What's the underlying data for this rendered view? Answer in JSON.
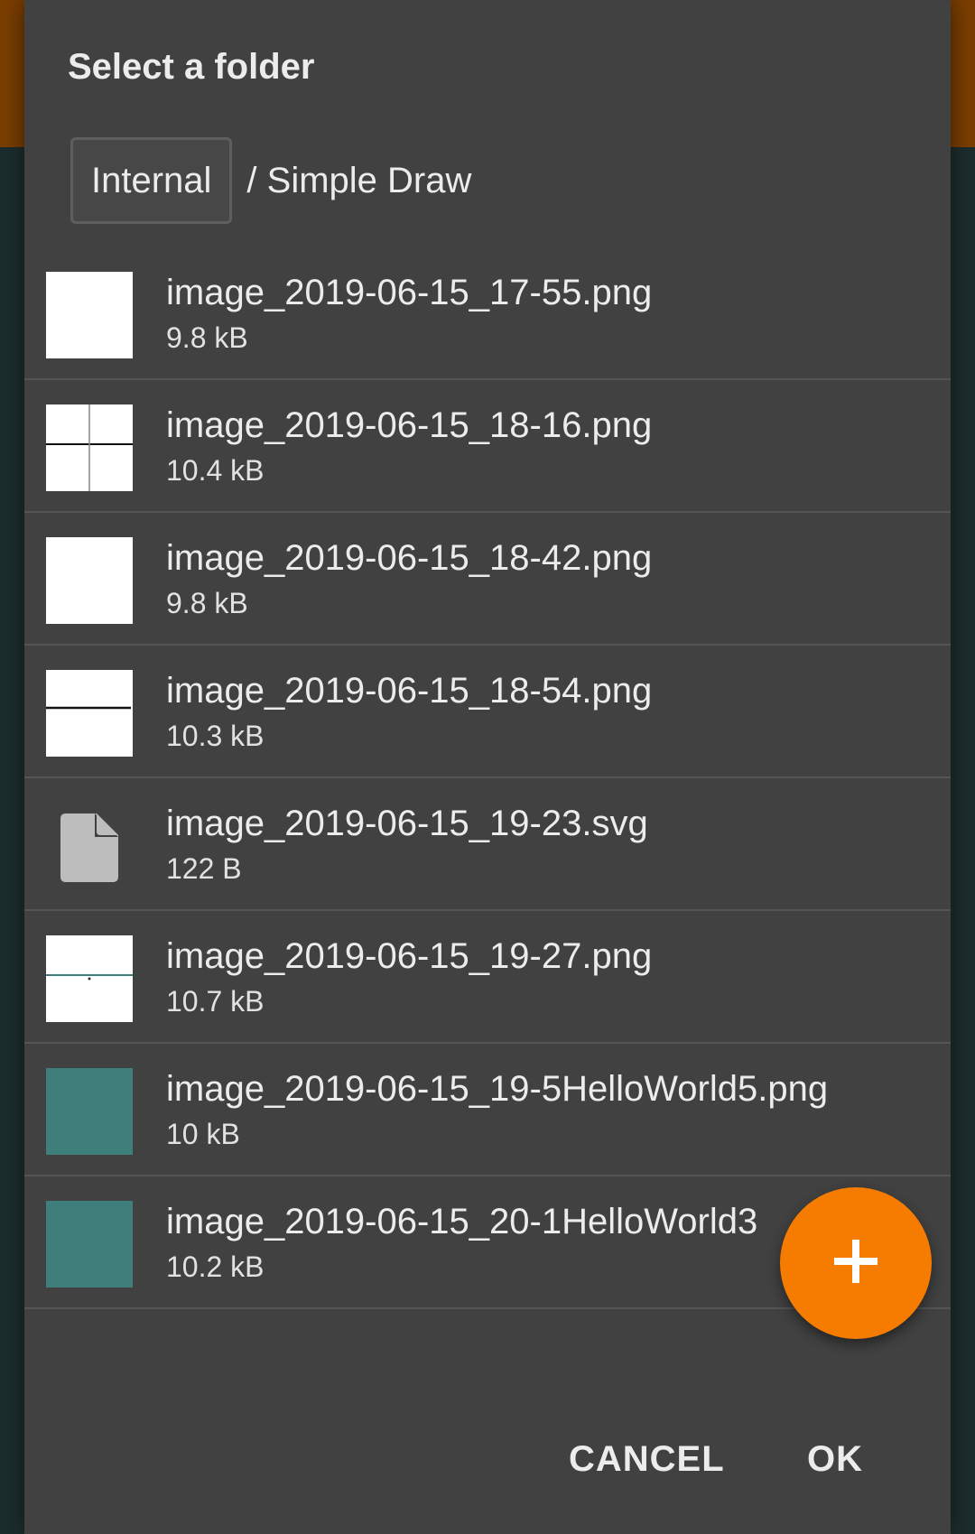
{
  "dialog": {
    "title": "Select a folder",
    "breadcrumb": {
      "root": "Internal",
      "path": "/ Simple Draw"
    },
    "files": [
      {
        "name": "image_2019-06-15_17-55.png",
        "size": "9.8 kB",
        "thumbnail": "white"
      },
      {
        "name": "image_2019-06-15_18-16.png",
        "size": "10.4 kB",
        "thumbnail": "white-cross"
      },
      {
        "name": "image_2019-06-15_18-42.png",
        "size": "9.8 kB",
        "thumbnail": "white"
      },
      {
        "name": "image_2019-06-15_18-54.png",
        "size": "10.3 kB",
        "thumbnail": "white-hline"
      },
      {
        "name": "image_2019-06-15_19-23.svg",
        "size": "122 B",
        "thumbnail": "file-icon"
      },
      {
        "name": "image_2019-06-15_19-27.png",
        "size": "10.7 kB",
        "thumbnail": "white-teal-line"
      },
      {
        "name": "image_2019-06-15_19-5HelloWorld5.png",
        "size": "10 kB",
        "thumbnail": "teal"
      },
      {
        "name": "image_2019-06-15_20-1HelloWorld3",
        "size": "10.2 kB",
        "thumbnail": "teal"
      }
    ],
    "fab": {
      "icon": "plus-icon"
    },
    "actions": {
      "cancel_label": "CANCEL",
      "ok_label": "OK"
    }
  },
  "colors": {
    "accent": "#f57c00",
    "dialog_bg": "#414141",
    "toolbar_bg": "#7a3e00",
    "thumbnail_teal": "#3e7f7b"
  }
}
